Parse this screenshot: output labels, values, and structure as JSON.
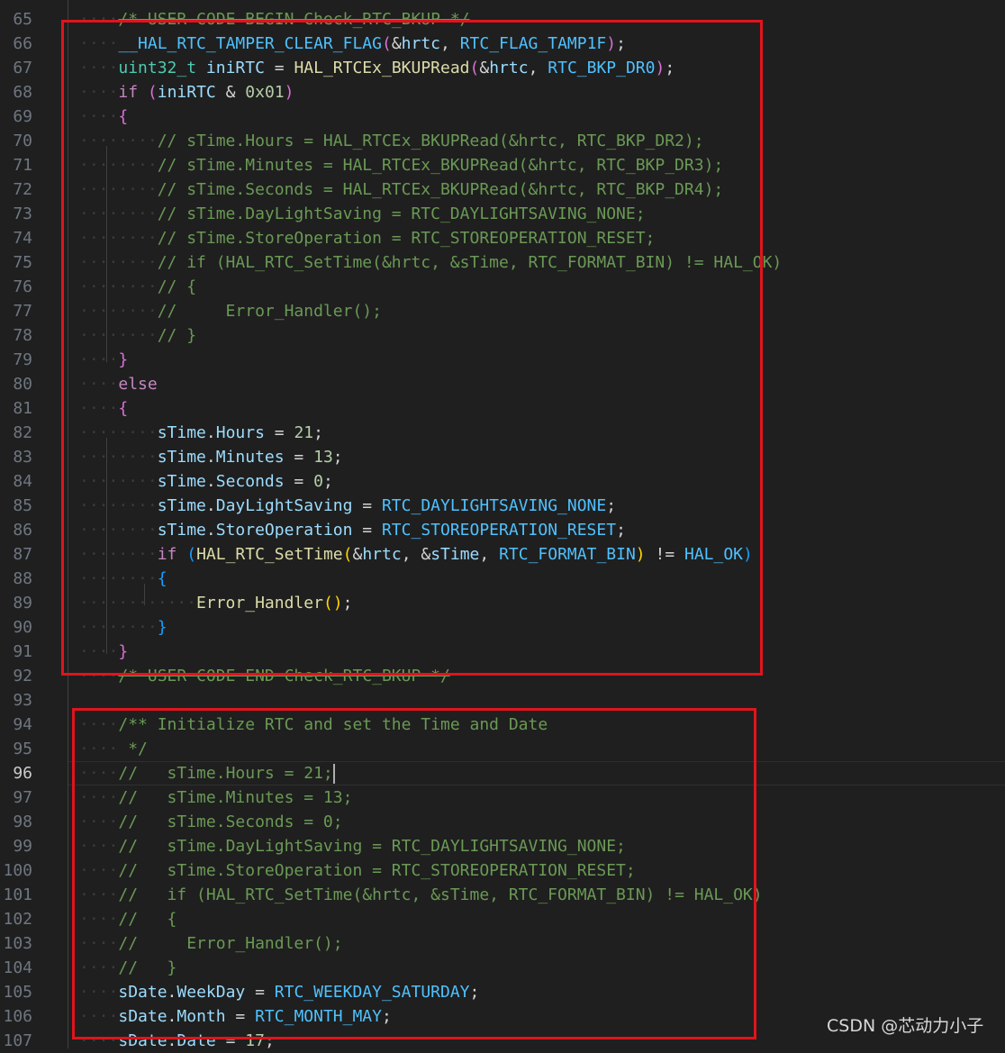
{
  "editor": {
    "active_line": "96",
    "lines": [
      {
        "no": "65",
        "tokens": [
          [
            "ws",
            "····"
          ],
          [
            "c strike",
            "/* USER CODE BEGIN Check_RTC_BKUP */"
          ]
        ]
      },
      {
        "no": "66",
        "tokens": [
          [
            "ws",
            "····"
          ],
          [
            "m",
            "__HAL_RTC_TAMPER_CLEAR_FLAG"
          ],
          [
            "b2",
            "("
          ],
          [
            "p",
            "&"
          ],
          [
            "v",
            "hrtc"
          ],
          [
            "p",
            ", "
          ],
          [
            "m",
            "RTC_FLAG_TAMP1F"
          ],
          [
            "b2",
            ")"
          ],
          [
            "p",
            ";"
          ]
        ]
      },
      {
        "no": "67",
        "tokens": [
          [
            "ws",
            "····"
          ],
          [
            "t",
            "uint32_t"
          ],
          [
            "p",
            " "
          ],
          [
            "v",
            "iniRTC"
          ],
          [
            "p",
            " = "
          ],
          [
            "fn",
            "HAL_RTCEx_BKUPRead"
          ],
          [
            "b2",
            "("
          ],
          [
            "p",
            "&"
          ],
          [
            "v",
            "hrtc"
          ],
          [
            "p",
            ", "
          ],
          [
            "m",
            "RTC_BKP_DR0"
          ],
          [
            "b2",
            ")"
          ],
          [
            "p",
            ";"
          ]
        ]
      },
      {
        "no": "68",
        "tokens": [
          [
            "ws",
            "····"
          ],
          [
            "k",
            "if"
          ],
          [
            "p",
            " "
          ],
          [
            "b2",
            "("
          ],
          [
            "v",
            "iniRTC"
          ],
          [
            "p",
            " & "
          ],
          [
            "n",
            "0x01"
          ],
          [
            "b2",
            ")"
          ]
        ]
      },
      {
        "no": "69",
        "tokens": [
          [
            "ws",
            "····"
          ],
          [
            "b2",
            "{"
          ]
        ]
      },
      {
        "no": "70",
        "tokens": [
          [
            "ws",
            "········"
          ],
          [
            "c",
            "// sTime.Hours = HAL_RTCEx_BKUPRead(&hrtc, RTC_BKP_DR2);"
          ]
        ]
      },
      {
        "no": "71",
        "tokens": [
          [
            "ws",
            "········"
          ],
          [
            "c",
            "// sTime.Minutes = HAL_RTCEx_BKUPRead(&hrtc, RTC_BKP_DR3);"
          ]
        ]
      },
      {
        "no": "72",
        "tokens": [
          [
            "ws",
            "········"
          ],
          [
            "c",
            "// sTime.Seconds = HAL_RTCEx_BKUPRead(&hrtc, RTC_BKP_DR4);"
          ]
        ]
      },
      {
        "no": "73",
        "tokens": [
          [
            "ws",
            "········"
          ],
          [
            "c",
            "// sTime.DayLightSaving = RTC_DAYLIGHTSAVING_NONE;"
          ]
        ]
      },
      {
        "no": "74",
        "tokens": [
          [
            "ws",
            "········"
          ],
          [
            "c",
            "// sTime.StoreOperation = RTC_STOREOPERATION_RESET;"
          ]
        ]
      },
      {
        "no": "75",
        "tokens": [
          [
            "ws",
            "········"
          ],
          [
            "c",
            "// if (HAL_RTC_SetTime(&hrtc, &sTime, RTC_FORMAT_BIN) != HAL_OK)"
          ]
        ]
      },
      {
        "no": "76",
        "tokens": [
          [
            "ws",
            "········"
          ],
          [
            "c",
            "// {"
          ]
        ]
      },
      {
        "no": "77",
        "tokens": [
          [
            "ws",
            "········"
          ],
          [
            "c",
            "//     Error_Handler();"
          ]
        ]
      },
      {
        "no": "78",
        "tokens": [
          [
            "ws",
            "········"
          ],
          [
            "c",
            "// }"
          ]
        ]
      },
      {
        "no": "79",
        "tokens": [
          [
            "ws",
            "····"
          ],
          [
            "b2",
            "}"
          ]
        ]
      },
      {
        "no": "80",
        "tokens": [
          [
            "ws",
            "····"
          ],
          [
            "k",
            "else"
          ]
        ]
      },
      {
        "no": "81",
        "tokens": [
          [
            "ws",
            "····"
          ],
          [
            "b2",
            "{"
          ]
        ]
      },
      {
        "no": "82",
        "tokens": [
          [
            "ws",
            "········"
          ],
          [
            "v",
            "sTime"
          ],
          [
            "p",
            "."
          ],
          [
            "v",
            "Hours"
          ],
          [
            "p",
            " = "
          ],
          [
            "n",
            "21"
          ],
          [
            "p",
            ";"
          ]
        ]
      },
      {
        "no": "83",
        "tokens": [
          [
            "ws",
            "········"
          ],
          [
            "v",
            "sTime"
          ],
          [
            "p",
            "."
          ],
          [
            "v",
            "Minutes"
          ],
          [
            "p",
            " = "
          ],
          [
            "n",
            "13"
          ],
          [
            "p",
            ";"
          ]
        ]
      },
      {
        "no": "84",
        "tokens": [
          [
            "ws",
            "········"
          ],
          [
            "v",
            "sTime"
          ],
          [
            "p",
            "."
          ],
          [
            "v",
            "Seconds"
          ],
          [
            "p",
            " = "
          ],
          [
            "n",
            "0"
          ],
          [
            "p",
            ";"
          ]
        ]
      },
      {
        "no": "85",
        "tokens": [
          [
            "ws",
            "········"
          ],
          [
            "v",
            "sTime"
          ],
          [
            "p",
            "."
          ],
          [
            "v",
            "DayLightSaving"
          ],
          [
            "p",
            " = "
          ],
          [
            "m",
            "RTC_DAYLIGHTSAVING_NONE"
          ],
          [
            "p",
            ";"
          ]
        ]
      },
      {
        "no": "86",
        "tokens": [
          [
            "ws",
            "········"
          ],
          [
            "v",
            "sTime"
          ],
          [
            "p",
            "."
          ],
          [
            "v",
            "StoreOperation"
          ],
          [
            "p",
            " = "
          ],
          [
            "m",
            "RTC_STOREOPERATION_RESET"
          ],
          [
            "p",
            ";"
          ]
        ]
      },
      {
        "no": "87",
        "tokens": [
          [
            "ws",
            "········"
          ],
          [
            "k",
            "if"
          ],
          [
            "p",
            " "
          ],
          [
            "b3",
            "("
          ],
          [
            "fn",
            "HAL_RTC_SetTime"
          ],
          [
            "b1",
            "("
          ],
          [
            "p",
            "&"
          ],
          [
            "v",
            "hrtc"
          ],
          [
            "p",
            ", &"
          ],
          [
            "v",
            "sTime"
          ],
          [
            "p",
            ", "
          ],
          [
            "m",
            "RTC_FORMAT_BIN"
          ],
          [
            "b1",
            ")"
          ],
          [
            "p",
            " != "
          ],
          [
            "m",
            "HAL_OK"
          ],
          [
            "b3",
            ")"
          ]
        ]
      },
      {
        "no": "88",
        "tokens": [
          [
            "ws",
            "········"
          ],
          [
            "b3",
            "{"
          ]
        ]
      },
      {
        "no": "89",
        "tokens": [
          [
            "ws",
            "············"
          ],
          [
            "fn",
            "Error_Handler"
          ],
          [
            "b1",
            "()"
          ],
          [
            "p",
            ";"
          ]
        ]
      },
      {
        "no": "90",
        "tokens": [
          [
            "ws",
            "········"
          ],
          [
            "b3",
            "}"
          ]
        ]
      },
      {
        "no": "91",
        "tokens": [
          [
            "ws",
            "····"
          ],
          [
            "b2",
            "}"
          ]
        ]
      },
      {
        "no": "92",
        "tokens": [
          [
            "ws",
            "····"
          ],
          [
            "c strike",
            "/* USER CODE END Check_RTC_BKUP */"
          ]
        ]
      },
      {
        "no": "93",
        "tokens": []
      },
      {
        "no": "94",
        "tokens": [
          [
            "ws",
            "····"
          ],
          [
            "c",
            "/** Initialize RTC and set the Time and Date"
          ]
        ]
      },
      {
        "no": "95",
        "tokens": [
          [
            "ws",
            "····"
          ],
          [
            "c",
            " */"
          ]
        ]
      },
      {
        "no": "96",
        "tokens": [
          [
            "ws",
            "····"
          ],
          [
            "c",
            "//   sTime.Hours = 21;"
          ]
        ],
        "caret": true
      },
      {
        "no": "97",
        "tokens": [
          [
            "ws",
            "····"
          ],
          [
            "c",
            "//   sTime.Minutes = 13;"
          ]
        ]
      },
      {
        "no": "98",
        "tokens": [
          [
            "ws",
            "····"
          ],
          [
            "c",
            "//   sTime.Seconds = 0;"
          ]
        ]
      },
      {
        "no": "99",
        "tokens": [
          [
            "ws",
            "····"
          ],
          [
            "c",
            "//   sTime.DayLightSaving = RTC_DAYLIGHTSAVING_NONE;"
          ]
        ]
      },
      {
        "no": "100",
        "tokens": [
          [
            "ws",
            "····"
          ],
          [
            "c",
            "//   sTime.StoreOperation = RTC_STOREOPERATION_RESET;"
          ]
        ]
      },
      {
        "no": "101",
        "tokens": [
          [
            "ws",
            "····"
          ],
          [
            "c",
            "//   if (HAL_RTC_SetTime(&hrtc, &sTime, RTC_FORMAT_BIN) != HAL_OK)"
          ]
        ]
      },
      {
        "no": "102",
        "tokens": [
          [
            "ws",
            "····"
          ],
          [
            "c",
            "//   {"
          ]
        ]
      },
      {
        "no": "103",
        "tokens": [
          [
            "ws",
            "····"
          ],
          [
            "c",
            "//     Error_Handler();"
          ]
        ]
      },
      {
        "no": "104",
        "tokens": [
          [
            "ws",
            "····"
          ],
          [
            "c",
            "//   }"
          ]
        ]
      },
      {
        "no": "105",
        "tokens": [
          [
            "ws",
            "····"
          ],
          [
            "v",
            "sDate"
          ],
          [
            "p",
            "."
          ],
          [
            "v",
            "WeekDay"
          ],
          [
            "p",
            " = "
          ],
          [
            "m",
            "RTC_WEEKDAY_SATURDAY"
          ],
          [
            "p",
            ";"
          ]
        ]
      },
      {
        "no": "106",
        "tokens": [
          [
            "ws",
            "····"
          ],
          [
            "v",
            "sDate"
          ],
          [
            "p",
            "."
          ],
          [
            "v",
            "Month"
          ],
          [
            "p",
            " = "
          ],
          [
            "m",
            "RTC_MONTH_MAY"
          ],
          [
            "p",
            ";"
          ]
        ]
      },
      {
        "no": "107",
        "tokens": [
          [
            "ws",
            "····"
          ],
          [
            "v",
            "sDate"
          ],
          [
            "p",
            "."
          ],
          [
            "v",
            "Date"
          ],
          [
            "p",
            " = "
          ],
          [
            "n",
            "17"
          ],
          [
            "p",
            ";"
          ]
        ]
      }
    ]
  },
  "watermark": "CSDN @芯动力小子",
  "colors": {
    "highlight_box": "#e0141c",
    "background": "#1f1f1f"
  }
}
